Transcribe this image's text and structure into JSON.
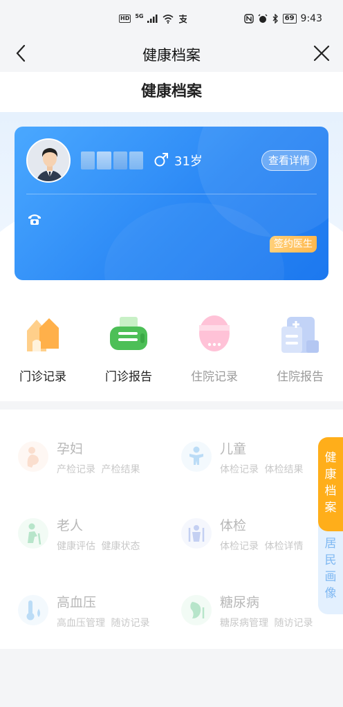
{
  "status_bar": {
    "network_badge": "HD",
    "network_type": "5G",
    "time": "9:43",
    "battery": "69"
  },
  "nav": {
    "title": "健康档案"
  },
  "page": {
    "heading": "健康档案"
  },
  "profile": {
    "age": "31岁",
    "detail_button": "查看详情",
    "sign_badge": "签约医生"
  },
  "quick_actions": [
    {
      "label": "门诊记录",
      "icon": "house-icon",
      "enabled": true
    },
    {
      "label": "门诊报告",
      "icon": "printer-icon",
      "enabled": true
    },
    {
      "label": "住院记录",
      "icon": "pill-icon",
      "enabled": false
    },
    {
      "label": "住院报告",
      "icon": "hospital-report-icon",
      "enabled": false
    }
  ],
  "services": [
    {
      "title": "孕妇",
      "links": [
        "产检记录",
        "产检结果"
      ],
      "icon": "pregnant-icon",
      "color": "#f6c6a8"
    },
    {
      "title": "儿童",
      "links": [
        "体检记录",
        "体检结果"
      ],
      "icon": "child-icon",
      "color": "#6fb6f0"
    },
    {
      "title": "老人",
      "links": [
        "健康评估",
        "健康状态"
      ],
      "icon": "elderly-icon",
      "color": "#5cc98c"
    },
    {
      "title": "体检",
      "links": [
        "体检记录",
        "体检详情"
      ],
      "icon": "checkup-icon",
      "color": "#8aa7ee"
    },
    {
      "title": "高血压",
      "links": [
        "高血压管理",
        "随访记录"
      ],
      "icon": "thermometer-icon",
      "color": "#6fb6f0"
    },
    {
      "title": "糖尿病",
      "links": [
        "糖尿病管理",
        "随访记录"
      ],
      "icon": "diabetes-icon",
      "color": "#5cc98c"
    }
  ],
  "side_tabs": [
    {
      "label": "健康档案",
      "active": true
    },
    {
      "label": "居民画像",
      "active": false
    }
  ],
  "colors": {
    "accent": "#2b88f5",
    "badge": "#ffb84d",
    "side_active": "#ffae1a"
  }
}
